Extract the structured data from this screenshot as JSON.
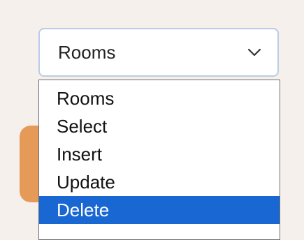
{
  "select": {
    "current_value": "Rooms",
    "icon": "chevron-down-icon"
  },
  "dropdown": {
    "options": [
      "Rooms",
      "Select",
      "Insert",
      "Update",
      "Delete"
    ],
    "highlighted_option": "Delete",
    "highlight_color": "#1967d2"
  },
  "colors": {
    "background": "#f5f0ec",
    "accent_card": "#e69a58",
    "select_border": "#b9cde6"
  }
}
